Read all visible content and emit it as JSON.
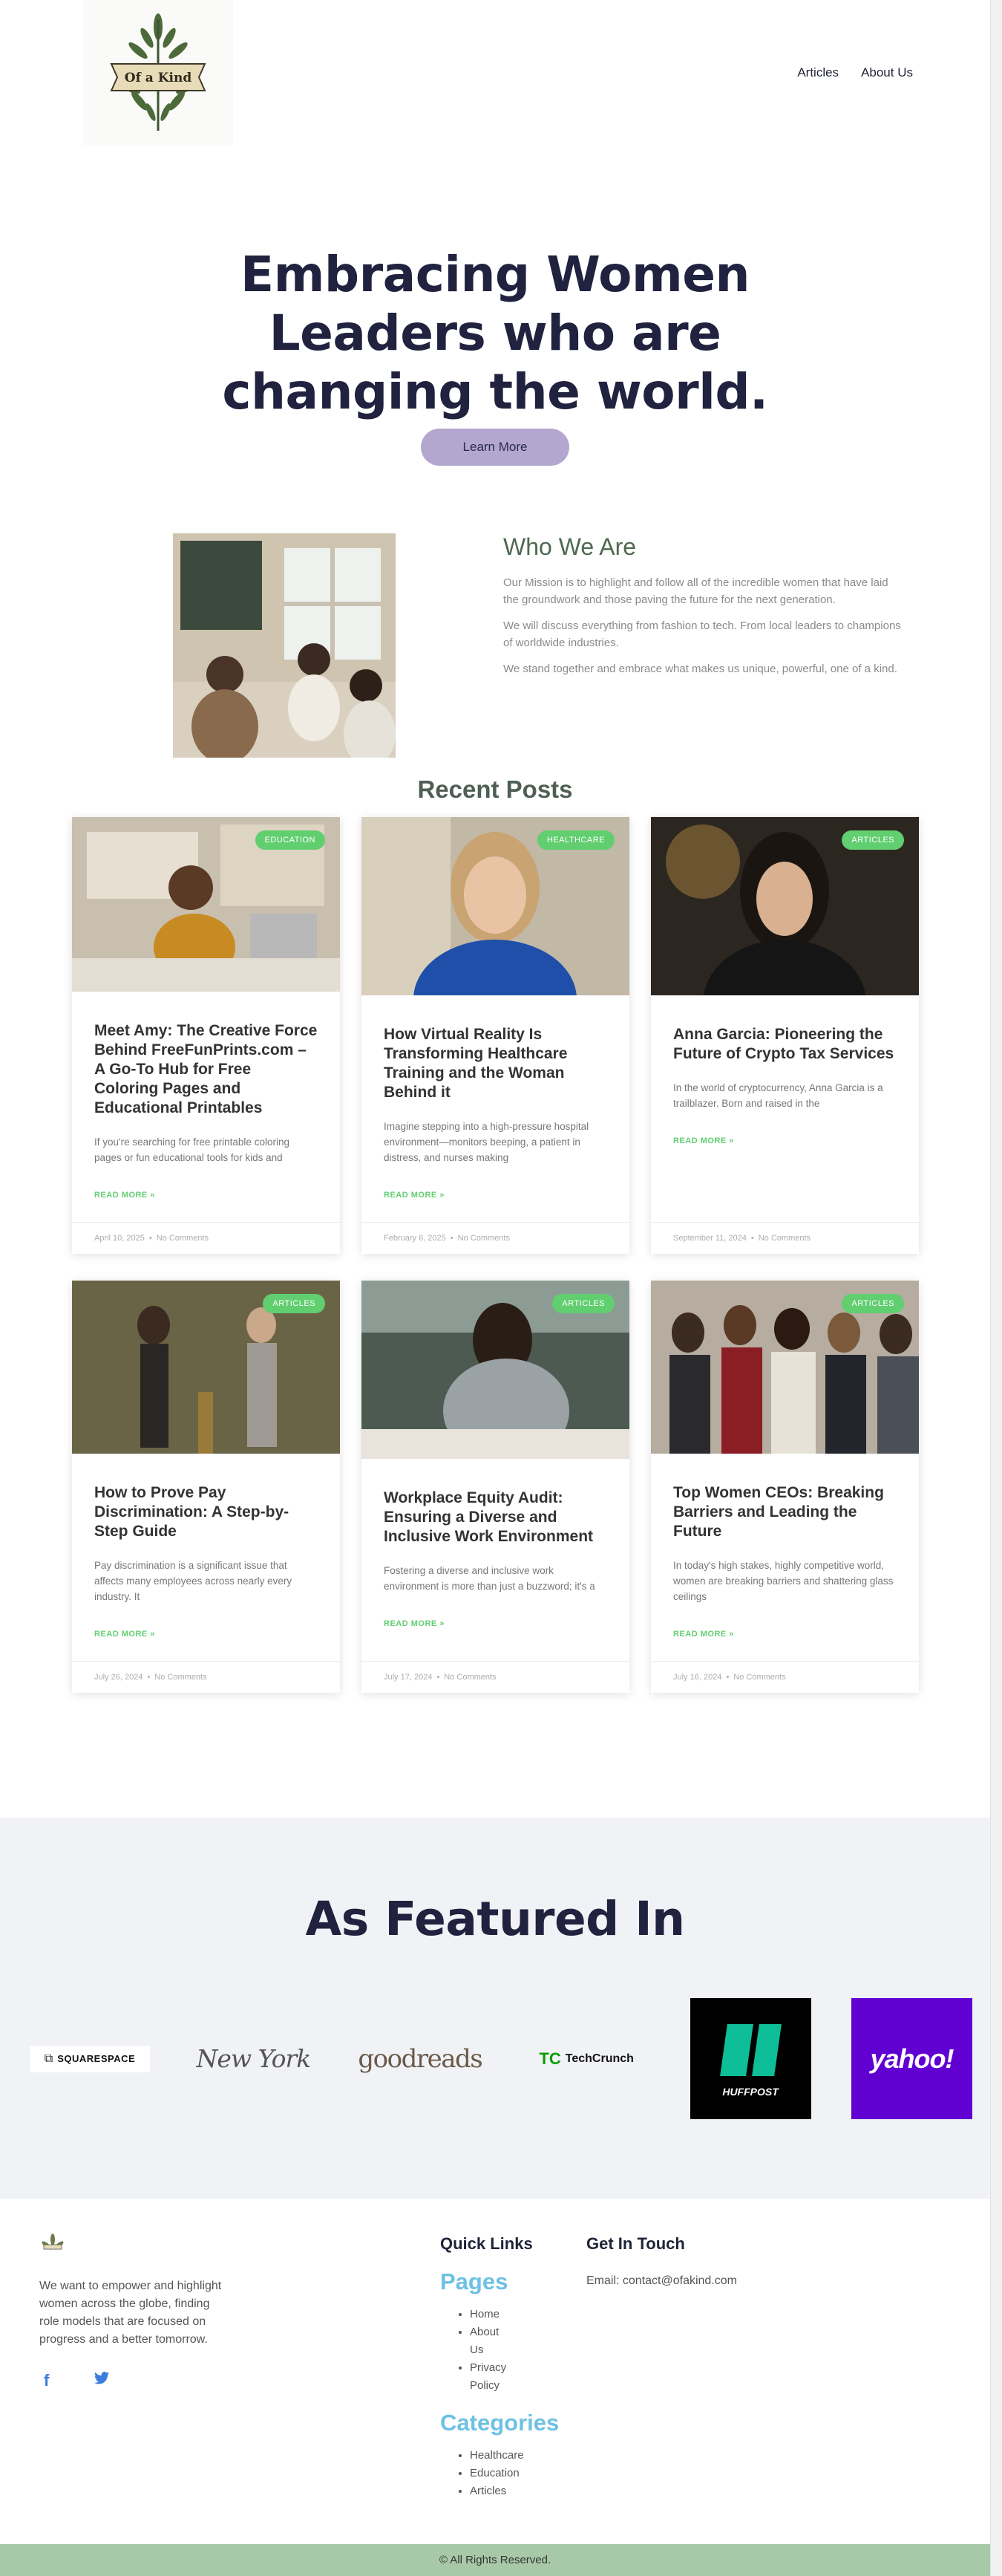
{
  "nav": {
    "logo_text": "Of a Kind",
    "links": [
      "Articles",
      "About Us"
    ]
  },
  "hero": {
    "title": "Embracing Women Leaders who are changing the world.",
    "button": "Learn More"
  },
  "who": {
    "heading": "Who We Are",
    "paragraphs": [
      "Our Mission is to highlight and follow all of the incredible women that have laid the groundwork and those paving the future for the next generation.",
      "We will discuss everything from fashion to tech. From local leaders to champions of worldwide industries.",
      "We stand together and embrace what makes us unique, powerful, one of a kind."
    ]
  },
  "recent": {
    "heading": "Recent Posts",
    "read_more": "READ MORE »",
    "posts": [
      {
        "badge": "EDUCATION",
        "title": "Meet Amy: The Creative Force Behind FreeFunPrints.com – A Go-To Hub for Free Coloring Pages and Educational Printables",
        "excerpt": "If you're searching for free printable coloring pages or fun educational tools for kids and",
        "date": "April 10, 2025",
        "comments": "No Comments"
      },
      {
        "badge": "HEALTHCARE",
        "title": "How Virtual Reality Is Transforming Healthcare Training and the Woman Behind it",
        "excerpt": "Imagine stepping into a high-pressure hospital environment—monitors beeping, a patient in distress, and nurses making",
        "date": "February 6, 2025",
        "comments": "No Comments"
      },
      {
        "badge": "ARTICLES",
        "title": "Anna Garcia: Pioneering the Future of Crypto Tax Services",
        "excerpt": "In the world of cryptocurrency, Anna Garcia is a trailblazer. Born and raised in the",
        "date": "September 11, 2024",
        "comments": "No Comments"
      },
      {
        "badge": "ARTICLES",
        "title": "How to Prove Pay Discrimination: A Step-by-Step Guide",
        "excerpt": "Pay discrimination is a significant issue that affects many employees across nearly every industry. It",
        "date": "July 26, 2024",
        "comments": "No Comments"
      },
      {
        "badge": "ARTICLES",
        "title": "Workplace Equity Audit: Ensuring a Diverse and Inclusive Work Environment",
        "excerpt": "Fostering a diverse and inclusive work environment is more than just a buzzword; it's a",
        "date": "July 17, 2024",
        "comments": "No Comments"
      },
      {
        "badge": "ARTICLES",
        "title": "Top Women CEOs: Breaking Barriers and Leading the Future",
        "excerpt": "In today's high stakes, highly competitive world, women are breaking barriers and shattering glass ceilings",
        "date": "July 16, 2024",
        "comments": "No Comments"
      }
    ]
  },
  "featured": {
    "heading": "As Featured In",
    "logos": [
      "SQUARESPACE",
      "New York",
      "goodreads",
      "TechCrunch",
      "HUFFPOST",
      "yahoo!"
    ]
  },
  "footer": {
    "about": "We want to empower and highlight women across the globe, finding role models that are focused on progress and a better tomorrow.",
    "quick_links": "Quick Links",
    "pages_heading": "Pages",
    "pages": [
      "Home",
      "About Us",
      "Privacy Policy"
    ],
    "categories_heading": "Categories",
    "categories": [
      "Healthcare",
      "Education",
      "Articles"
    ],
    "contact_heading": "Get In Touch",
    "email": "Email: contact@ofakind.com",
    "copyright": "© All Rights Reserved."
  },
  "colors": {
    "accent_green": "#61ce70",
    "navy": "#20223f",
    "lavender": "#b3a7d0",
    "sage": "#a8c9a8",
    "link_blue": "#6ec1e4"
  }
}
